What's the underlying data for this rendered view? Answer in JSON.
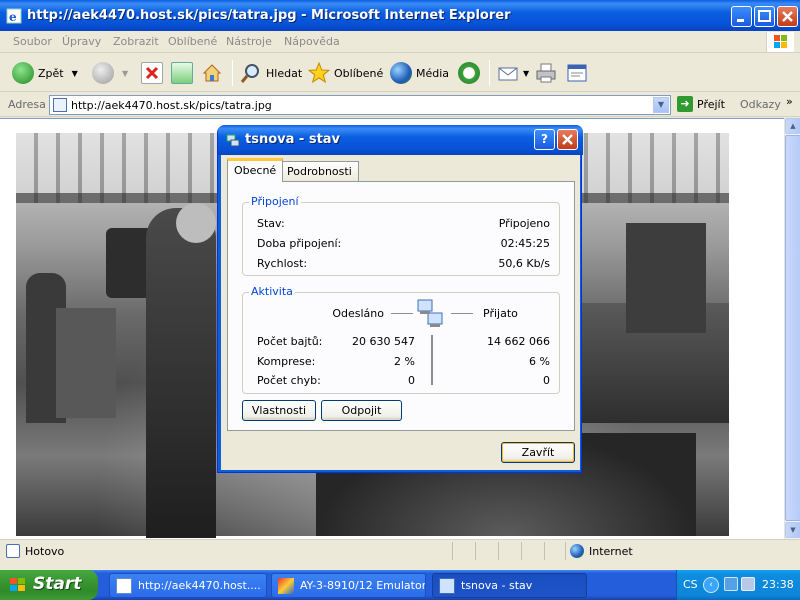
{
  "browser": {
    "title": "http://aek4470.host.sk/pics/tatra.jpg - Microsoft Internet Explorer",
    "menu": [
      "Soubor",
      "Úpravy",
      "Zobrazit",
      "Oblíbené",
      "Nástroje",
      "Nápověda"
    ],
    "toolbar": {
      "back": "Zpět",
      "search": "Hledat",
      "favorites": "Oblíbené",
      "media": "Média"
    },
    "address": {
      "label": "Adresa",
      "url": "http://aek4470.host.sk/pics/tatra.jpg",
      "go": "Přejít",
      "links": "Odkazy",
      "chevron": "»"
    },
    "status": {
      "left": "Hotovo",
      "zone": "Internet"
    }
  },
  "dialog": {
    "title": "tsnova - stav",
    "tabs": [
      "Obecné",
      "Podrobnosti"
    ],
    "connection": {
      "legend": "Připojení",
      "status_label": "Stav:",
      "status_value": "Připojeno",
      "duration_label": "Doba připojení:",
      "duration_value": "02:45:25",
      "speed_label": "Rychlost:",
      "speed_value": "50,6 Kb/s"
    },
    "activity": {
      "legend": "Aktivita",
      "sent_header": "Odesláno",
      "received_header": "Přijato",
      "bytes_label": "Počet bajtů:",
      "bytes_sent": "20 630 547",
      "bytes_received": "14 662 066",
      "compression_label": "Komprese:",
      "compression_sent": "2 %",
      "compression_received": "6 %",
      "errors_label": "Počet chyb:",
      "errors_sent": "0",
      "errors_received": "0"
    },
    "buttons": {
      "properties": "Vlastnosti",
      "disconnect": "Odpojit",
      "close": "Zavřít"
    }
  },
  "taskbar": {
    "start": "Start",
    "tasks": [
      {
        "label": "http://aek4470.host...."
      },
      {
        "label": "AY-3-8910/12 Emulator"
      },
      {
        "label": "tsnova - stav"
      }
    ],
    "tray": {
      "lang": "CS",
      "clock": "23:38"
    }
  }
}
